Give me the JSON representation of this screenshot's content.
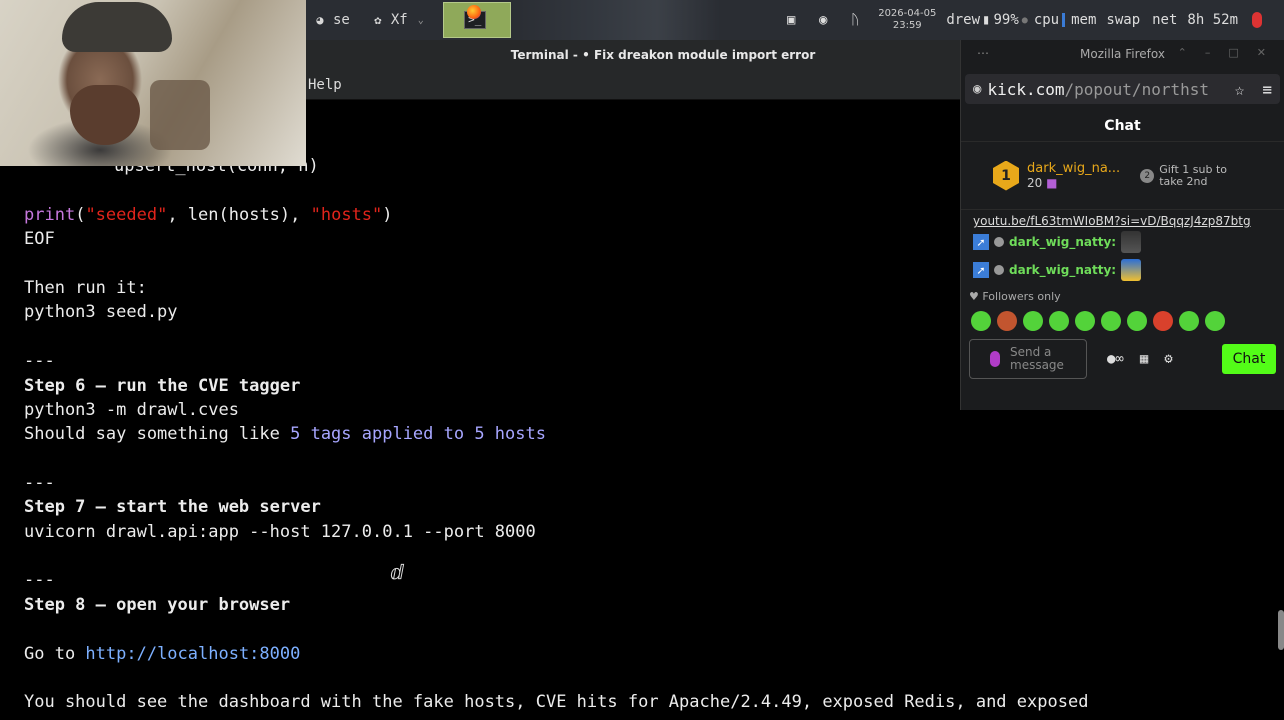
{
  "taskbar": {
    "tasks": [
      {
        "label": "se",
        "icon": "camera-icon"
      },
      {
        "label": "Xf",
        "icon": "xfce-mouse-icon"
      }
    ],
    "clock": {
      "date": "2026-04-05",
      "time": "23:59"
    },
    "user": "drew",
    "battery": "99%",
    "monitors": [
      "cpu",
      "mem",
      "swap",
      "net"
    ],
    "uptime": "8h 52m"
  },
  "terminal": {
    "title": "Terminal - • Fix dreakon module import error",
    "menu_help": "Help",
    "lines": {
      "l_upsert": "upsert_host(conn, h)",
      "l_print_kw": "print",
      "l_print_a": "(",
      "l_print_s1": "\"seeded\"",
      "l_print_b": ", len(hosts), ",
      "l_print_s2": "\"hosts\"",
      "l_print_c": ")",
      "l_eof": "EOF",
      "l_then": "Then run it:",
      "l_seed": "python3 seed.py",
      "l_sep1": "---",
      "l_step6": "Step 6 — run the CVE tagger",
      "l_cves": "python3 -m drawl.cves",
      "l_should_a": "Should say something like ",
      "l_should_b": "5 tags applied to 5 hosts",
      "l_sep2": "---",
      "l_step7": "Step 7 — start the web server",
      "l_uvicorn": "uvicorn drawl.api:app --host 127.0.0.1 --port 8000",
      "l_sep3": "---",
      "l_step8": "Step 8 — open your browser",
      "l_goto_a": "Go to ",
      "l_goto_b": "http://localhost:8000",
      "l_final": "You should see the dashboard with the fake hosts, CVE hits for Apache/2.4.49, exposed Redis, and exposed"
    }
  },
  "firefox": {
    "window_title": "Mozilla Firefox",
    "url_host": "kick.com",
    "url_path": "/popout/northst",
    "chat_title": "Chat",
    "top_gifter": {
      "rank": "1",
      "name": "dark_wig_na...",
      "count": "20"
    },
    "gift_cta": "Gift 1 sub to take 2nd",
    "gift_cta_num": "2",
    "link_message": "youtu.be/fL63tmWIoBM?si=vD/BqqzJ4zp87btg",
    "messages": [
      {
        "user": "dark_wig_natty:"
      },
      {
        "user": "dark_wig_natty:"
      }
    ],
    "followers_only": "Followers only",
    "input_placeholder": "Send a message",
    "send_label": "Chat"
  }
}
